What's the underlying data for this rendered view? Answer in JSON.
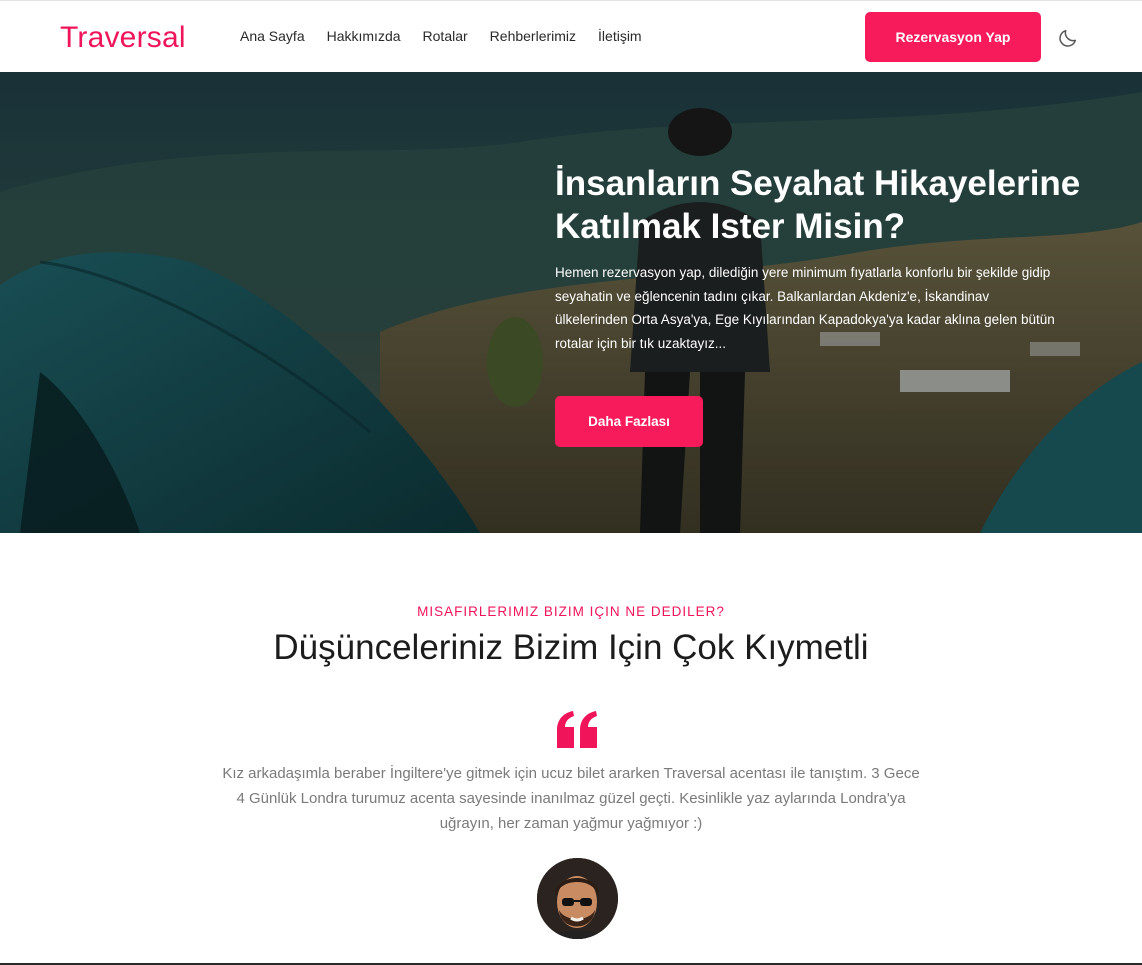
{
  "brand": {
    "logo": "Traversal",
    "accent": "#f81b5b"
  },
  "nav": {
    "links": [
      "Ana Sayfa",
      "Hakkımızda",
      "Rotalar",
      "Rehberlerimiz",
      "İletişim"
    ],
    "reserve_label": "Rezervasyon Yap",
    "theme_icon": "moon-icon"
  },
  "hero": {
    "title": "İnsanların Seyahat Hikayelerine Katılmak Ister Misin?",
    "text": "Hemen rezervasyon yap, dilediğin yere minimum fıyatlarla konforlu bir şekilde gidip seyahatin ve eğlencenin tadını çıkar. Balkanlardan Akdeniz'e, İskandinav ülkelerinden Orta Asya'ya, Ege Kıyılarından Kapadokya'ya kadar aklına gelen bütün rotalar için bir tık uzaktayız...",
    "button_label": "Daha Fazlası"
  },
  "testimonials": {
    "eyebrow": "MISAFIRLERIMIZ BIZIM IÇIN NE DEDILER?",
    "title": "Düşünceleriniz Bizim Için Çok Kıymetli",
    "quote_icon": "quote-icon",
    "quote": "Kız arkadaşımla beraber İngiltere'ye gitmek için ucuz bilet ararken Traversal acentası ile tanıştım. 3 Gece 4 Günlük Londra turumuz acenta sayesinde inanılmaz güzel geçti. Kesinlikle yaz aylarında Londra'ya uğrayın, her zaman yağmur yağmıyor :)"
  }
}
